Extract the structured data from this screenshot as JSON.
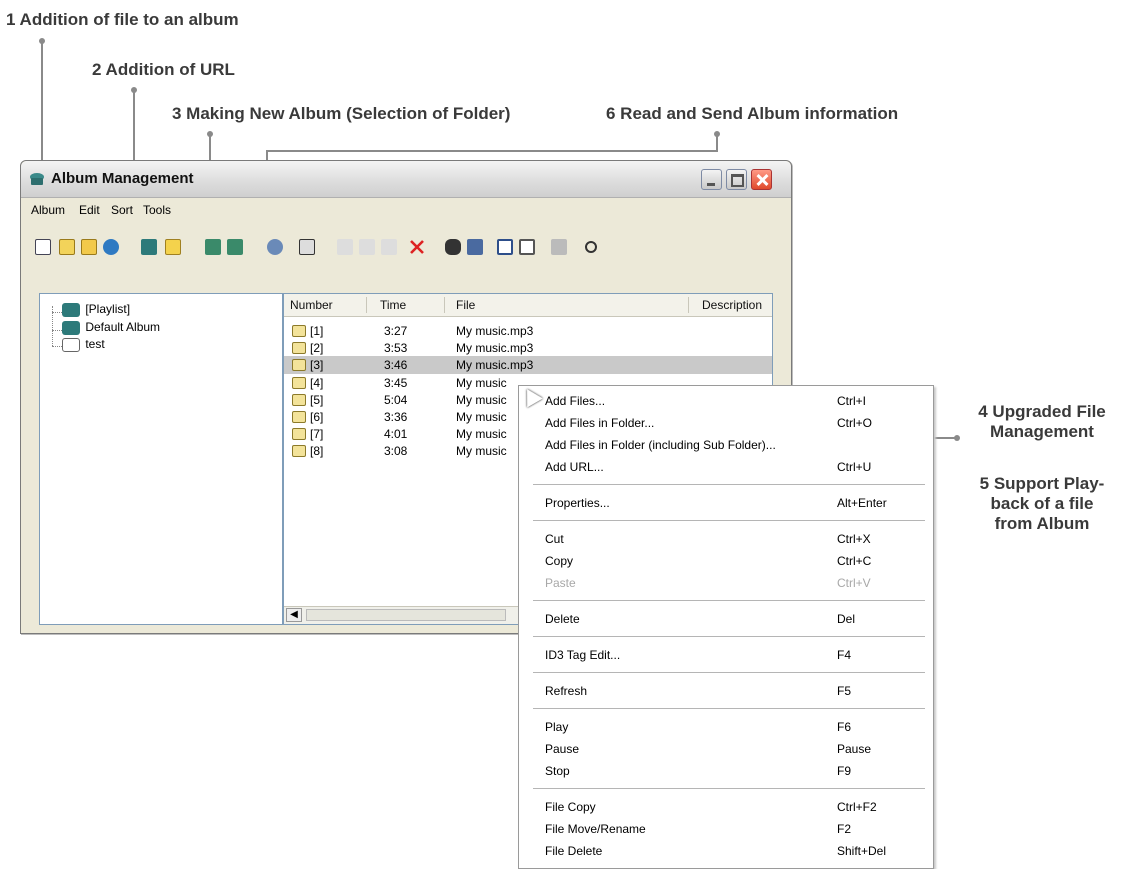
{
  "callouts": {
    "c1": "1 Addition of file to an album",
    "c2": "2 Addition of URL",
    "c3": "3 Making New Album (Selection of Folder)",
    "c6": "6 Read and Send Album information",
    "c4_line1": "4 Upgraded File",
    "c4_line2": "Management",
    "c5_line1": "5 Support Play-",
    "c5_line2": "back of a file",
    "c5_line3": "from Album"
  },
  "window": {
    "title": "Album Management",
    "menu": [
      "Album",
      "Edit",
      "Sort",
      "Tools"
    ]
  },
  "toolbar_icons": [
    "new-file-icon",
    "add-folder-icon",
    "open-folder-icon",
    "add-url-globe-icon",
    "album-icon",
    "new-album-folder-icon",
    "read-album-icon",
    "send-album-icon",
    "search-icon",
    "properties-icon",
    "cut-icon",
    "copy-icon",
    "paste-icon",
    "delete-icon",
    "find-icon",
    "find-next-icon",
    "check-icon",
    "uncheck-icon",
    "info-icon",
    "refresh-icon"
  ],
  "tree": {
    "items": [
      "[Playlist]",
      "Default Album",
      "test"
    ]
  },
  "list": {
    "columns": [
      "Number",
      "Time",
      "File",
      "Description"
    ],
    "rows": [
      {
        "number": "[1]",
        "time": "3:27",
        "file": "My music.mp3"
      },
      {
        "number": "[2]",
        "time": "3:53",
        "file": "My music.mp3"
      },
      {
        "number": "[3]",
        "time": "3:46",
        "file": "My music.mp3"
      },
      {
        "number": "[4]",
        "time": "3:45",
        "file": "My music"
      },
      {
        "number": "[5]",
        "time": "5:04",
        "file": "My music"
      },
      {
        "number": "[6]",
        "time": "3:36",
        "file": "My music"
      },
      {
        "number": "[7]",
        "time": "4:01",
        "file": "My music"
      },
      {
        "number": "[8]",
        "time": "3:08",
        "file": "My music"
      }
    ],
    "selected_index": 2
  },
  "context_menu": [
    {
      "label": "Add Files...",
      "shortcut": "Ctrl+I"
    },
    {
      "label": "Add Files in Folder...",
      "shortcut": "Ctrl+O"
    },
    {
      "label": "Add Files in Folder (including Sub Folder)...",
      "shortcut": ""
    },
    {
      "label": "Add URL...",
      "shortcut": "Ctrl+U"
    },
    {
      "label": "Properties...",
      "shortcut": "Alt+Enter"
    },
    {
      "label": "Cut",
      "shortcut": "Ctrl+X"
    },
    {
      "label": "Copy",
      "shortcut": "Ctrl+C"
    },
    {
      "label": "Paste",
      "shortcut": "Ctrl+V",
      "disabled": true
    },
    {
      "label": "Delete",
      "shortcut": "Del"
    },
    {
      "label": "ID3 Tag Edit...",
      "shortcut": "F4"
    },
    {
      "label": "Refresh",
      "shortcut": "F5"
    },
    {
      "label": "Play",
      "shortcut": "F6"
    },
    {
      "label": "Pause",
      "shortcut": "Pause"
    },
    {
      "label": "Stop",
      "shortcut": "F9"
    },
    {
      "label": "File Copy",
      "shortcut": "Ctrl+F2"
    },
    {
      "label": "File Move/Rename",
      "shortcut": "F2"
    },
    {
      "label": "File Delete",
      "shortcut": "Shift+Del"
    }
  ]
}
